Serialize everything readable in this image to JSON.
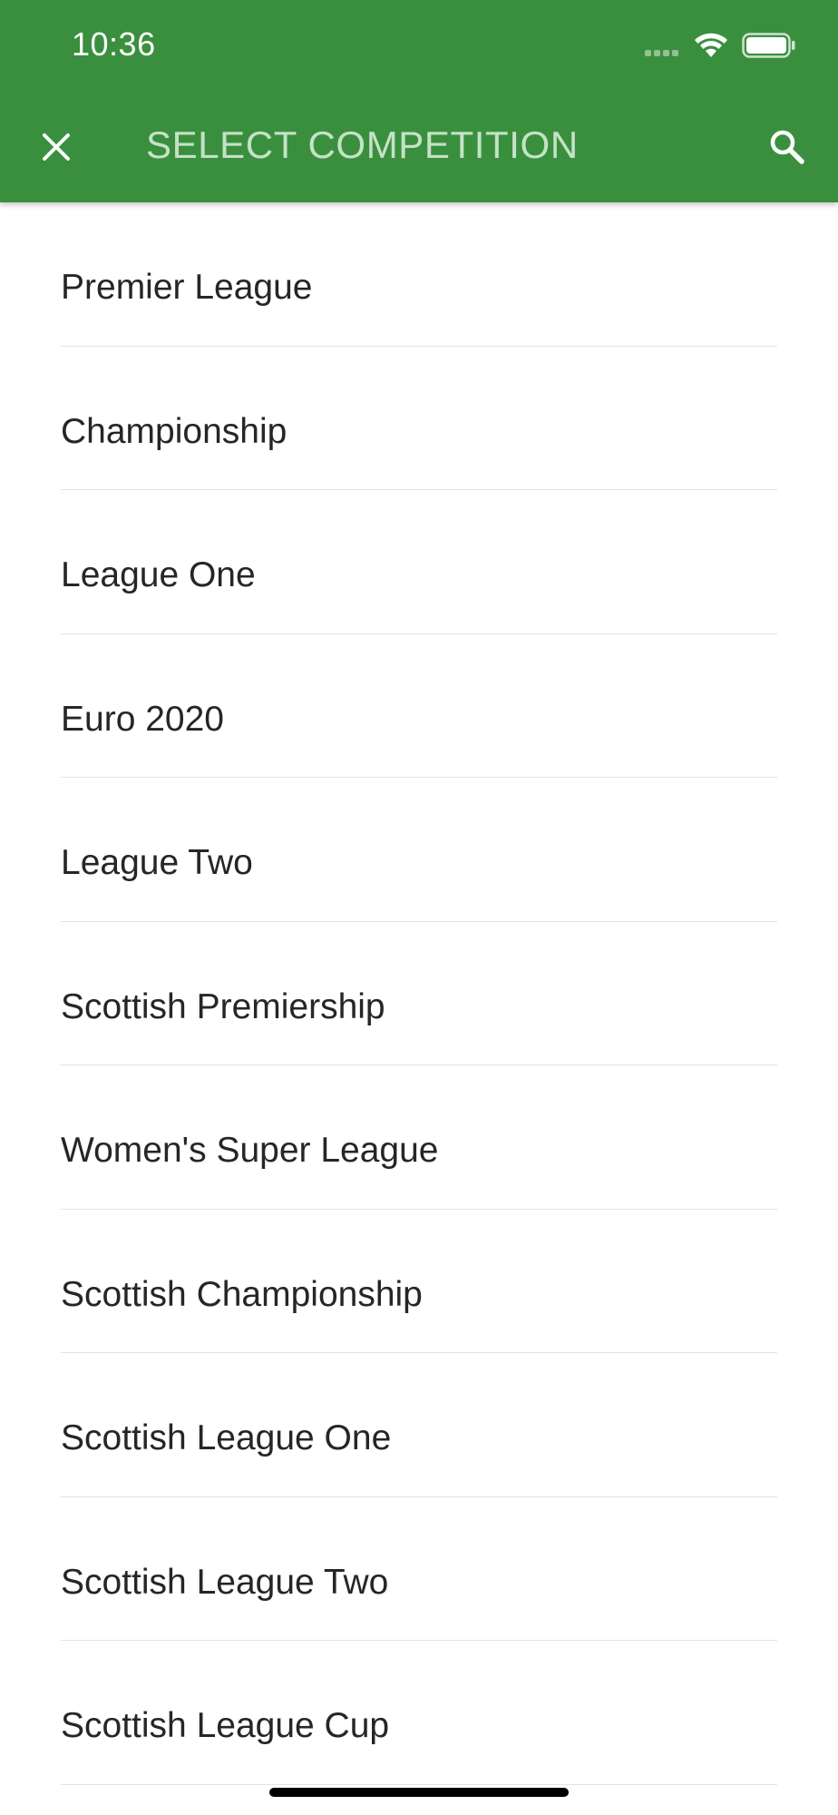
{
  "status_bar": {
    "time": "10:36"
  },
  "header": {
    "title": "SELECT COMPETITION",
    "close_icon": "close-icon",
    "search_icon": "search-icon",
    "background_color": "#3a8f3e",
    "title_color": "#c5e2c6"
  },
  "competitions": [
    {
      "label": "Premier League"
    },
    {
      "label": "Championship"
    },
    {
      "label": "League One"
    },
    {
      "label": "Euro 2020"
    },
    {
      "label": "League Two"
    },
    {
      "label": "Scottish Premiership"
    },
    {
      "label": "Women's Super League"
    },
    {
      "label": "Scottish Championship"
    },
    {
      "label": "Scottish League One"
    },
    {
      "label": "Scottish League Two"
    },
    {
      "label": "Scottish League Cup"
    }
  ]
}
